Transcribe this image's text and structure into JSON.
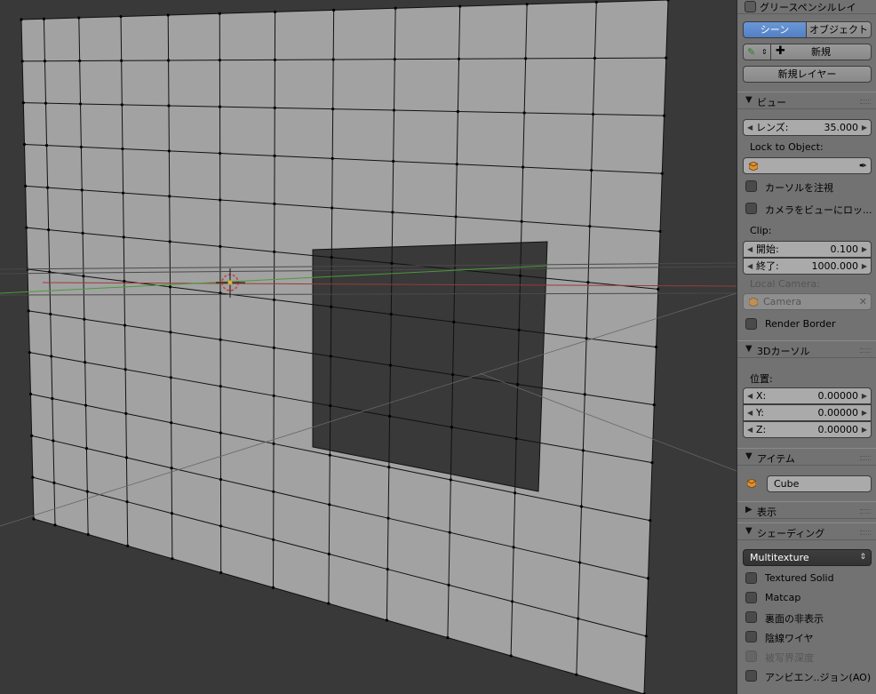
{
  "viewport": {
    "description_icon": "3d-cursor-icon"
  },
  "panel": {
    "grease_pencil": {
      "title": "グリースペンシルレイ",
      "tab_scene": "シーン",
      "tab_object": "オブジェクト",
      "new_label": "新規",
      "new_layer_label": "新規レイヤー"
    },
    "view": {
      "title": "ビュー",
      "lens_label": "レンズ:",
      "lens_value": "35.000",
      "lock_label": "Lock to Object:",
      "lock_cursor_label": "カーソルを注視",
      "lock_camera_label": "カメラをビューにロッ...",
      "clip_label": "Clip:",
      "clip_start_label": "開始:",
      "clip_start_value": "0.100",
      "clip_end_label": "終了:",
      "clip_end_value": "1000.000",
      "local_camera_label": "Local Camera:",
      "local_camera_value": "Camera",
      "render_border_label": "Render Border"
    },
    "cursor3d": {
      "title": "3Dカーソル",
      "location_label": "位置:",
      "x_label": "X:",
      "x_value": "0.00000",
      "y_label": "Y:",
      "y_value": "0.00000",
      "z_label": "Z:",
      "z_value": "0.00000"
    },
    "item": {
      "title": "アイテム",
      "name": "Cube"
    },
    "display": {
      "title": "表示"
    },
    "shading": {
      "title": "シェーディング",
      "mode": "Multitexture",
      "options": [
        "Textured Solid",
        "Matcap",
        "裏面の非表示",
        "陰線ワイヤ",
        "被写界深度",
        "アンビエン..ジョン(AO)"
      ]
    }
  },
  "colors": {
    "panel_bg": "#727272",
    "viewport_bg": "#393939",
    "mesh_face": "#a2a2a2",
    "accent_blue": "#5680c4",
    "axis_red": "#9a3a3a",
    "axis_green": "#4a9a3a"
  }
}
